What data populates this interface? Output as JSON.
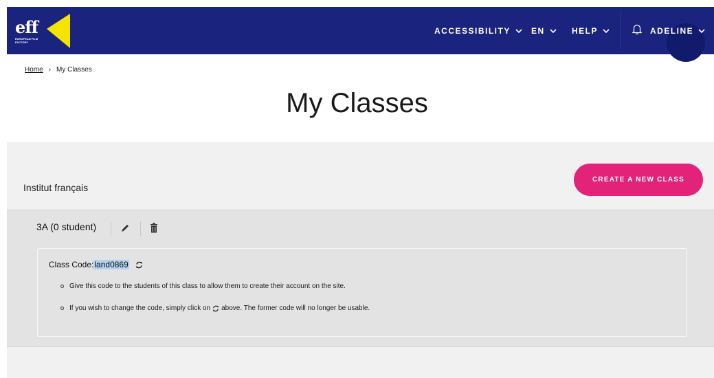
{
  "header": {
    "logo": {
      "mark": "eff",
      "subtitle": "EUROPEAN FILM FACTORY"
    },
    "nav": [
      {
        "label": "ACCESSIBILITY"
      },
      {
        "label": "EN"
      },
      {
        "label": "HELP"
      }
    ],
    "user": {
      "label": "ADELINE"
    },
    "icons": {
      "notifications": "bell-icon",
      "dropdown": "chevron-down-icon"
    }
  },
  "breadcrumb": {
    "home": "Home",
    "separator": "›",
    "current": "My Classes"
  },
  "page": {
    "title": "My Classes"
  },
  "institution": {
    "name": "Institut français"
  },
  "actions": {
    "create_class": "CREATE A NEW CLASS"
  },
  "class": {
    "name": "3A (0 student)",
    "icons": {
      "edit": "pencil-icon",
      "delete": "trash-icon",
      "regenerate": "refresh-icon"
    },
    "code_label": "Class Code:",
    "code_value": "land0869",
    "instructions": {
      "first": "Give this code to the students of this class to allow them to create their account on the site.",
      "second_before": "If you wish to change the code, simply click on",
      "second_after": "above. The former code will no longer be usable."
    }
  },
  "colors": {
    "header_bg": "#1a237e",
    "accent_pink": "#e3237a",
    "logo_yellow": "#f5e400",
    "panel_bg": "#f1f1f1",
    "class_panel_bg": "#e3e3e3",
    "highlight": "#b4d1f0"
  }
}
